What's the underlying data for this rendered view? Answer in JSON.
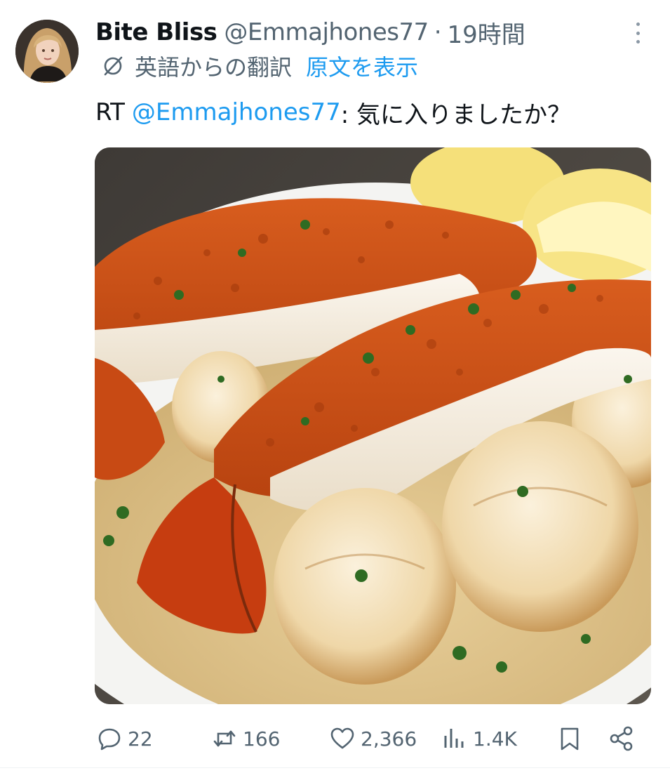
{
  "author": {
    "display_name": "Bite Bliss",
    "handle": "@Emmajhones77",
    "separator": "·",
    "time": "19時間"
  },
  "translation": {
    "label": "英語からの翻訳",
    "show_original": "原文を表示"
  },
  "tweet": {
    "prefix": "RT",
    "mention": "@Emmajhones77",
    "body": ": 気に入りましたか？"
  },
  "actions": {
    "reply": {
      "icon": "reply-icon",
      "count": "22"
    },
    "retweet": {
      "icon": "retweet-icon",
      "count": "166"
    },
    "like": {
      "icon": "heart-icon",
      "count": "2,366"
    },
    "views": {
      "icon": "views-icon",
      "count": "1.4K"
    },
    "bookmark": {
      "icon": "bookmark-icon"
    },
    "share": {
      "icon": "share-icon"
    }
  },
  "colors": {
    "text": "#0f1419",
    "secondary": "#536471",
    "link": "#1d9bf0"
  }
}
